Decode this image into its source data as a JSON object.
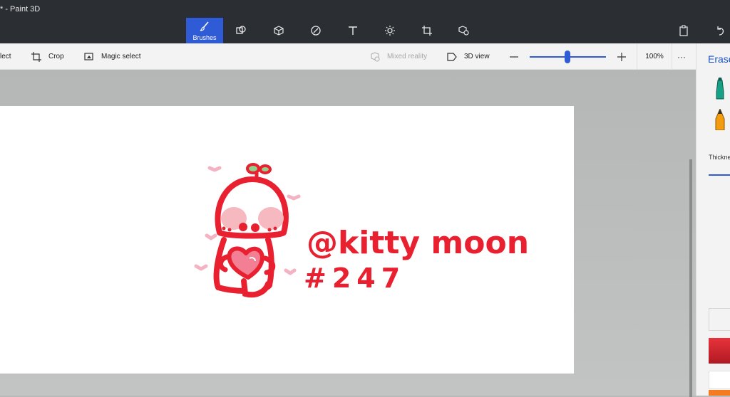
{
  "window": {
    "title": "* - Paint 3D"
  },
  "toolbar": {
    "tools": [
      {
        "name": "Brushes",
        "icon": "brush-icon",
        "active": true
      },
      {
        "name": "2D shapes",
        "icon": "2d-shapes-icon"
      },
      {
        "name": "3D shapes",
        "icon": "3d-shapes-icon"
      },
      {
        "name": "Stickers",
        "icon": "stickers-icon"
      },
      {
        "name": "Text",
        "icon": "text-icon"
      },
      {
        "name": "Effects",
        "icon": "effects-icon"
      },
      {
        "name": "Canvas",
        "icon": "canvas-icon"
      },
      {
        "name": "3D library",
        "icon": "3d-library-icon"
      }
    ],
    "right_icons": [
      "paste-icon",
      "undo-icon"
    ]
  },
  "subbar": {
    "select_label": "lect",
    "crop_label": "Crop",
    "magic_select_label": "Magic select",
    "mixed_reality_label": "Mixed reality",
    "view_3d_label": "3D view",
    "zoom_value": "100%",
    "zoom_level": 0.5,
    "more_label": "···"
  },
  "sidepanel": {
    "title": "Erase",
    "thickness_label": "Thickne",
    "swatches": [
      "#f7f7f7",
      "#e8323c",
      "#ffffff",
      "#f47b20"
    ]
  },
  "canvas_text": {
    "handle": "@kitty moon",
    "number": "#247"
  },
  "colors": {
    "accent": "#2f5bd6",
    "ink": "#e8202f",
    "pink": "#f4b3c2",
    "leaf": "#8fd18a"
  }
}
